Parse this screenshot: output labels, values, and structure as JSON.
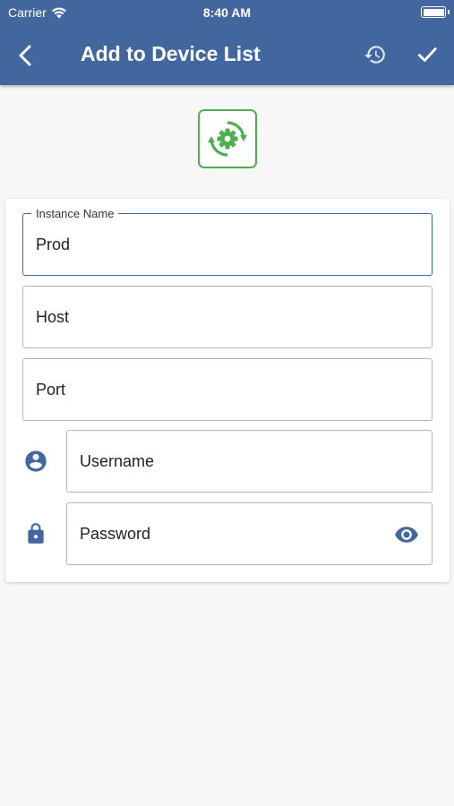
{
  "status_bar": {
    "carrier": "Carrier",
    "time": "8:40 AM",
    "wifi_icon": "wifi-icon",
    "battery_icon": "battery-icon"
  },
  "nav": {
    "title": "Add to Device List",
    "back_icon": "chevron-left-icon",
    "history_icon": "history-icon",
    "confirm_icon": "check-icon"
  },
  "logo": {
    "icon": "sync-gear-icon",
    "color": "#4caf50"
  },
  "form": {
    "instance_name": {
      "label": "Instance Name",
      "value": "Prod"
    },
    "host": {
      "placeholder": "Host"
    },
    "port": {
      "placeholder": "Port"
    },
    "username": {
      "placeholder": "Username",
      "icon": "account-circle-icon"
    },
    "password": {
      "placeholder": "Password",
      "icon": "lock-icon",
      "toggle_icon": "eye-icon"
    }
  },
  "colors": {
    "header": "#42679e",
    "accent": "#42679e",
    "logo": "#4caf50",
    "background": "#f7f7f7"
  }
}
